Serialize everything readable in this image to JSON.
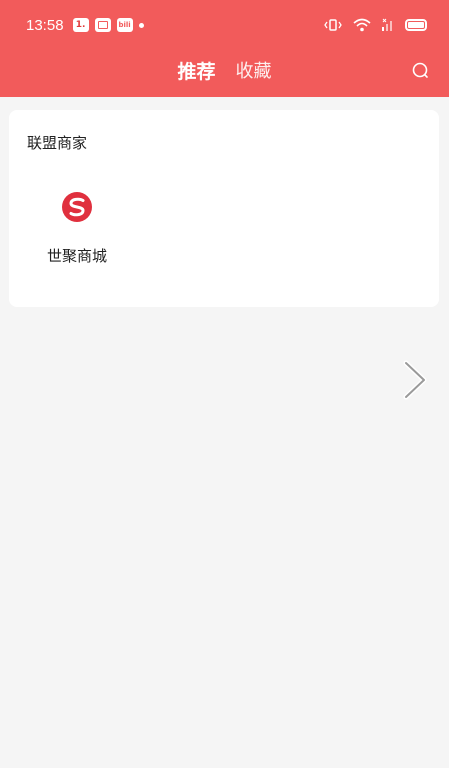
{
  "status_bar": {
    "time": "13:58",
    "notification_badge": "1.",
    "bili_text": "bili"
  },
  "nav": {
    "tabs": [
      {
        "label": "推荐",
        "active": true
      },
      {
        "label": "收藏",
        "active": false
      }
    ],
    "search_icon": "search-icon"
  },
  "alliance": {
    "title": "联盟商家",
    "merchants": [
      {
        "name": "世聚商城",
        "logo_icon": "shiju-logo-icon"
      }
    ]
  },
  "colors": {
    "header": "#f25b5b",
    "background": "#f5f5f5",
    "card": "#ffffff",
    "logo": "#e0303e"
  },
  "next_icon": "chevron-right-icon"
}
